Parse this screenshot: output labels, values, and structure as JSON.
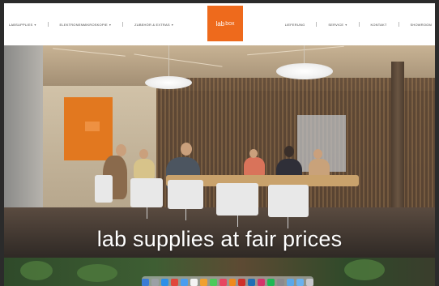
{
  "header": {
    "nav_left": [
      {
        "label": "Labsupplies",
        "chevron": true
      },
      {
        "label": "Elektronenmikroskopie",
        "chevron": true
      },
      {
        "label": "Zubehör & Extras",
        "chevron": true
      }
    ],
    "logo": {
      "part1": "lab",
      "part2": "box"
    },
    "nav_right": [
      {
        "label": "Lieferung",
        "chevron": false
      },
      {
        "label": "Service",
        "chevron": true
      },
      {
        "label": "Kontakt",
        "chevron": false
      },
      {
        "label": "Showroom",
        "chevron": false
      }
    ]
  },
  "hero": {
    "headline": "lab supplies at fair prices"
  },
  "colors": {
    "brand_orange": "#ee6a1c",
    "header_bg": "#ffffff",
    "headline_text": "#ffffff"
  },
  "dock": {
    "icons": [
      {
        "name": "finder-icon",
        "color": "#3a7bd5"
      },
      {
        "name": "launchpad-icon",
        "color": "#9aa0a6"
      },
      {
        "name": "safari-icon",
        "color": "#2c8fe8"
      },
      {
        "name": "chrome-icon",
        "color": "#e0463a"
      },
      {
        "name": "mail-icon",
        "color": "#4a9df0"
      },
      {
        "name": "calendar-icon",
        "color": "#f4f4f4"
      },
      {
        "name": "photos-icon",
        "color": "#f0a030"
      },
      {
        "name": "messages-icon",
        "color": "#4ccb5a"
      },
      {
        "name": "music-icon",
        "color": "#e84560"
      },
      {
        "name": "illustrator-icon",
        "color": "#f08a1c"
      },
      {
        "name": "acrobat-icon",
        "color": "#d0302a"
      },
      {
        "name": "photoshop-icon",
        "color": "#1f6fb5"
      },
      {
        "name": "indesign-icon",
        "color": "#d4346b"
      },
      {
        "name": "spotify-icon",
        "color": "#1db954"
      },
      {
        "name": "settings-icon",
        "color": "#8a8a8f"
      },
      {
        "name": "folder-icon",
        "color": "#5aa7e8"
      },
      {
        "name": "downloads-icon",
        "color": "#69b1ee"
      },
      {
        "name": "trash-icon",
        "color": "#c7c7cc"
      }
    ]
  }
}
